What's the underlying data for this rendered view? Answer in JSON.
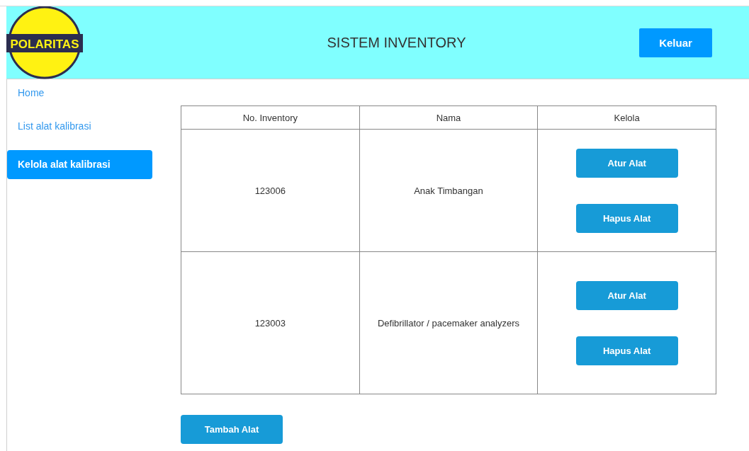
{
  "header": {
    "logo_text": "POLARITAS",
    "title": "SISTEM INVENTORY",
    "logout_button": "Keluar"
  },
  "sidebar": {
    "items": [
      {
        "label": "Home",
        "selected": false
      },
      {
        "label": "List alat kalibrasi",
        "selected": false
      },
      {
        "label": "Kelola alat kalibrasi",
        "selected": true
      }
    ]
  },
  "table": {
    "columns": [
      "No. Inventory",
      "Nama",
      "Kelola"
    ],
    "rows": [
      {
        "no_inventory": "123006",
        "nama": "Anak Timbangan",
        "actions": [
          "Atur Alat",
          "Hapus Alat"
        ]
      },
      {
        "no_inventory": "123003",
        "nama": "Defibrillator / pacemaker analyzers",
        "actions": [
          "Atur Alat",
          "Hapus Alat"
        ]
      }
    ]
  },
  "add_button": "Tambah Alat"
}
